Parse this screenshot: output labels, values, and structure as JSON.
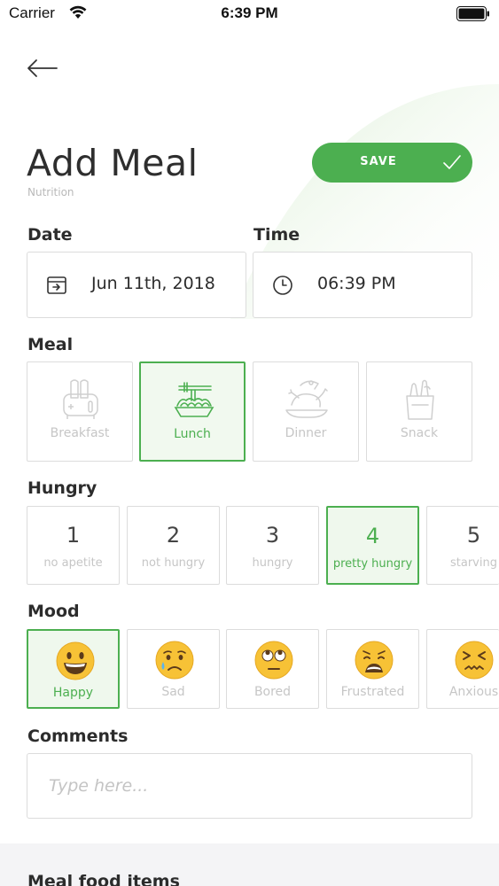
{
  "status_bar": {
    "carrier": "Carrier",
    "time": "6:39 PM"
  },
  "header": {
    "title": "Add Meal",
    "subtitle": "Nutrition",
    "save_label": "SAVE"
  },
  "date": {
    "label": "Date",
    "value": "Jun 11th, 2018"
  },
  "time": {
    "label": "Time",
    "value": "06:39 PM"
  },
  "meal": {
    "label": "Meal",
    "selected": "Lunch",
    "options": [
      {
        "label": "Breakfast",
        "icon": "toaster-icon"
      },
      {
        "label": "Lunch",
        "icon": "noodles-icon"
      },
      {
        "label": "Dinner",
        "icon": "roast-chicken-icon"
      },
      {
        "label": "Snack",
        "icon": "grocery-bag-icon"
      }
    ]
  },
  "hungry": {
    "label": "Hungry",
    "selected": 4,
    "options": [
      {
        "value": "1",
        "label": "no apetite"
      },
      {
        "value": "2",
        "label": "not hungry"
      },
      {
        "value": "3",
        "label": "hungry"
      },
      {
        "value": "4",
        "label": "pretty hungry"
      },
      {
        "value": "5",
        "label": "starving"
      }
    ]
  },
  "mood": {
    "label": "Mood",
    "selected": "Happy",
    "options": [
      {
        "label": "Happy",
        "icon": "grinning-face-icon"
      },
      {
        "label": "Sad",
        "icon": "crying-face-icon"
      },
      {
        "label": "Bored",
        "icon": "eye-roll-face-icon"
      },
      {
        "label": "Frustrated",
        "icon": "weary-face-icon"
      },
      {
        "label": "Anxious",
        "icon": "confounded-face-icon"
      }
    ]
  },
  "comments": {
    "label": "Comments",
    "placeholder": "Type here...",
    "value": ""
  },
  "food_items": {
    "title": "Meal food items"
  },
  "colors": {
    "accent": "#4caf50",
    "border": "#dcdcdc",
    "muted_text": "#c6c6c6"
  }
}
